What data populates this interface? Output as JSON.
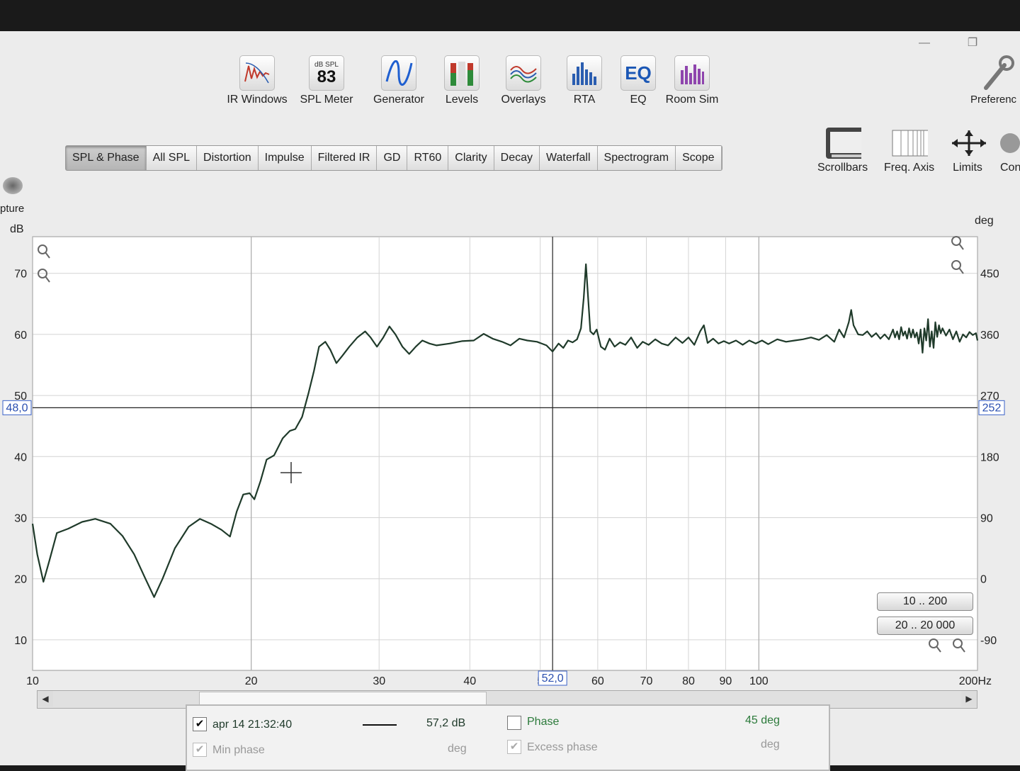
{
  "window": {
    "minimize": "—",
    "restore": "❐"
  },
  "toolbar": {
    "items": [
      {
        "label": "IR Windows",
        "icon": "ir-windows-icon"
      },
      {
        "label": "SPL Meter",
        "icon": "spl-meter-icon",
        "meter_unit": "dB SPL",
        "meter_value": "83"
      },
      {
        "label": "Generator",
        "icon": "sine-wave-icon"
      },
      {
        "label": "Levels",
        "icon": "levels-icon"
      },
      {
        "label": "Overlays",
        "icon": "overlays-icon"
      },
      {
        "label": "RTA",
        "icon": "rta-icon"
      },
      {
        "label": "EQ",
        "icon": "eq-icon",
        "icon_text": "EQ"
      },
      {
        "label": "Room Sim",
        "icon": "room-sim-icon"
      }
    ],
    "preferences_label": "Preferenc",
    "capture_label": "pture"
  },
  "tabs": [
    "SPL & Phase",
    "All SPL",
    "Distortion",
    "Impulse",
    "Filtered IR",
    "GD",
    "RT60",
    "Clarity",
    "Decay",
    "Waterfall",
    "Spectrogram",
    "Scope"
  ],
  "active_tab": "SPL & Phase",
  "right_buttons": [
    {
      "label": "Scrollbars",
      "icon": "scrollbars-icon"
    },
    {
      "label": "Freq. Axis",
      "icon": "freq-axis-icon"
    },
    {
      "label": "Limits",
      "icon": "limits-icon"
    },
    {
      "label": "Con",
      "icon": "controls-icon"
    }
  ],
  "chart_data": {
    "type": "line",
    "x_scale": "log",
    "xlim": [
      10,
      200
    ],
    "ylim": [
      5,
      76
    ],
    "y2lim": [
      -135,
      504
    ],
    "xlabel": "Hz",
    "ylabel": "dB",
    "y2label": "deg",
    "x_ticks": [
      10,
      20,
      30,
      40,
      50,
      60,
      70,
      80,
      90,
      100,
      200
    ],
    "x_tick_labels": [
      "10",
      "20",
      "30",
      "40",
      "5",
      "60",
      "70",
      "80",
      "90",
      "100",
      "200Hz"
    ],
    "y_ticks": [
      10,
      20,
      30,
      40,
      50,
      60,
      70
    ],
    "y2_ticks": [
      -90,
      0,
      90,
      180,
      270,
      360,
      450
    ],
    "grid": true,
    "cursor": {
      "x": 52.0,
      "x_label": "52,0",
      "y_left": 48.0,
      "y_left_label": "48,0",
      "y_right_label": "252"
    },
    "series": [
      {
        "color": "#1f3a2a",
        "points": [
          [
            10,
            29
          ],
          [
            10.15,
            24
          ],
          [
            10.35,
            19.5
          ],
          [
            10.55,
            23
          ],
          [
            10.8,
            27.5
          ],
          [
            11.2,
            28.2
          ],
          [
            11.7,
            29.3
          ],
          [
            12.2,
            29.8
          ],
          [
            12.8,
            29
          ],
          [
            13.3,
            27
          ],
          [
            13.8,
            24
          ],
          [
            14.3,
            20
          ],
          [
            14.7,
            17
          ],
          [
            15.1,
            20
          ],
          [
            15.7,
            25
          ],
          [
            16.4,
            28.5
          ],
          [
            17.0,
            29.8
          ],
          [
            17.6,
            29
          ],
          [
            18.2,
            28
          ],
          [
            18.7,
            26.9
          ],
          [
            19.1,
            31
          ],
          [
            19.5,
            33.8
          ],
          [
            19.9,
            34
          ],
          [
            20.2,
            33
          ],
          [
            20.6,
            36
          ],
          [
            21.0,
            39.5
          ],
          [
            21.5,
            40.2
          ],
          [
            22.1,
            43
          ],
          [
            22.6,
            44.2
          ],
          [
            23.0,
            44.5
          ],
          [
            23.5,
            46.5
          ],
          [
            24.0,
            50.5
          ],
          [
            24.4,
            54
          ],
          [
            24.8,
            58
          ],
          [
            25.3,
            58.8
          ],
          [
            25.7,
            57.5
          ],
          [
            26.2,
            55.3
          ],
          [
            26.7,
            56.5
          ],
          [
            27.3,
            58
          ],
          [
            28.0,
            59.5
          ],
          [
            28.7,
            60.5
          ],
          [
            29.2,
            59.5
          ],
          [
            29.8,
            58
          ],
          [
            30.4,
            59.5
          ],
          [
            31.0,
            61.3
          ],
          [
            31.6,
            60
          ],
          [
            32.3,
            58
          ],
          [
            33.0,
            56.8
          ],
          [
            33.7,
            58
          ],
          [
            34.4,
            59
          ],
          [
            35.2,
            58.5
          ],
          [
            36,
            58.2
          ],
          [
            37.5,
            58.5
          ],
          [
            39,
            58.9
          ],
          [
            40.5,
            59
          ],
          [
            41.8,
            60.1
          ],
          [
            43,
            59.3
          ],
          [
            44.3,
            58.8
          ],
          [
            45.5,
            58.2
          ],
          [
            46.8,
            59.3
          ],
          [
            48,
            59
          ],
          [
            49.5,
            58.8
          ],
          [
            51,
            58.2
          ],
          [
            52,
            57.2
          ],
          [
            53,
            58.5
          ],
          [
            53.8,
            57.8
          ],
          [
            54.6,
            59
          ],
          [
            55.4,
            58.7
          ],
          [
            56.2,
            59.2
          ],
          [
            56.9,
            61
          ],
          [
            57.4,
            66
          ],
          [
            57.8,
            71.5
          ],
          [
            58.2,
            66
          ],
          [
            58.6,
            60.5
          ],
          [
            59.2,
            60
          ],
          [
            59.8,
            60.8
          ],
          [
            60.6,
            58
          ],
          [
            61.4,
            57.5
          ],
          [
            62.3,
            59.3
          ],
          [
            63.3,
            58
          ],
          [
            64.4,
            58.7
          ],
          [
            65.5,
            58.3
          ],
          [
            66.7,
            59.5
          ],
          [
            68,
            57.8
          ],
          [
            69.2,
            58.8
          ],
          [
            70.5,
            58.3
          ],
          [
            72,
            59.2
          ],
          [
            73.5,
            58.5
          ],
          [
            75,
            58.2
          ],
          [
            76.8,
            59.5
          ],
          [
            78.5,
            58.6
          ],
          [
            80,
            59.5
          ],
          [
            81.5,
            58.3
          ],
          [
            83,
            60.5
          ],
          [
            84,
            61.5
          ],
          [
            85,
            58.6
          ],
          [
            86.5,
            59.3
          ],
          [
            88,
            58.5
          ],
          [
            89.5,
            58.9
          ],
          [
            91,
            58.5
          ],
          [
            93,
            59
          ],
          [
            95,
            58.3
          ],
          [
            97,
            59
          ],
          [
            99,
            58.5
          ],
          [
            101,
            59
          ],
          [
            103,
            58.4
          ],
          [
            106,
            59.2
          ],
          [
            109,
            58.8
          ],
          [
            112,
            59
          ],
          [
            115,
            59.2
          ],
          [
            118,
            59.5
          ],
          [
            121,
            59.1
          ],
          [
            124,
            59.9
          ],
          [
            127,
            58.8
          ],
          [
            129,
            60.8
          ],
          [
            131,
            59.5
          ],
          [
            133,
            62
          ],
          [
            134,
            64
          ],
          [
            135,
            61.5
          ],
          [
            137,
            60
          ],
          [
            139,
            59.9
          ],
          [
            141,
            60.5
          ],
          [
            143,
            59.6
          ],
          [
            145,
            60.2
          ],
          [
            147,
            59.3
          ],
          [
            149,
            60
          ],
          [
            151,
            59.2
          ],
          [
            153,
            60.8
          ],
          [
            154,
            59.5
          ],
          [
            155,
            60.5
          ],
          [
            156,
            59.2
          ],
          [
            157,
            61.2
          ],
          [
            158,
            59.8
          ],
          [
            159,
            60.5
          ],
          [
            160,
            59.3
          ],
          [
            161,
            61
          ],
          [
            162,
            59.5
          ],
          [
            163,
            60.8
          ],
          [
            164,
            59.5
          ],
          [
            165,
            60.3
          ],
          [
            166,
            58.5
          ],
          [
            167,
            60.8
          ],
          [
            168,
            57
          ],
          [
            169,
            61
          ],
          [
            170,
            59
          ],
          [
            171,
            62.5
          ],
          [
            172,
            58
          ],
          [
            173,
            60.5
          ],
          [
            174,
            57.8
          ],
          [
            175,
            62
          ],
          [
            176,
            59.6
          ],
          [
            177,
            61.5
          ],
          [
            178,
            60.2
          ],
          [
            179,
            61
          ],
          [
            181,
            59.8
          ],
          [
            183,
            60.8
          ],
          [
            185,
            59.2
          ],
          [
            187,
            60.5
          ],
          [
            189,
            58.8
          ],
          [
            191,
            60
          ],
          [
            193,
            59.5
          ],
          [
            195,
            60.4
          ],
          [
            197,
            59.9
          ],
          [
            199,
            60.2
          ],
          [
            200,
            59
          ]
        ]
      }
    ]
  },
  "range_buttons": [
    "10 .. 200",
    "20 .. 20 000"
  ],
  "legend": {
    "meas_name": "apr 14 21:32:40",
    "meas_checked": "✔",
    "meas_value": "57,2 dB",
    "min_phase_label": "Min phase",
    "min_phase_unit": "deg",
    "phase_label": "Phase",
    "phase_value": "45 deg",
    "excess_phase_label": "Excess phase",
    "excess_phase_unit": "deg"
  }
}
